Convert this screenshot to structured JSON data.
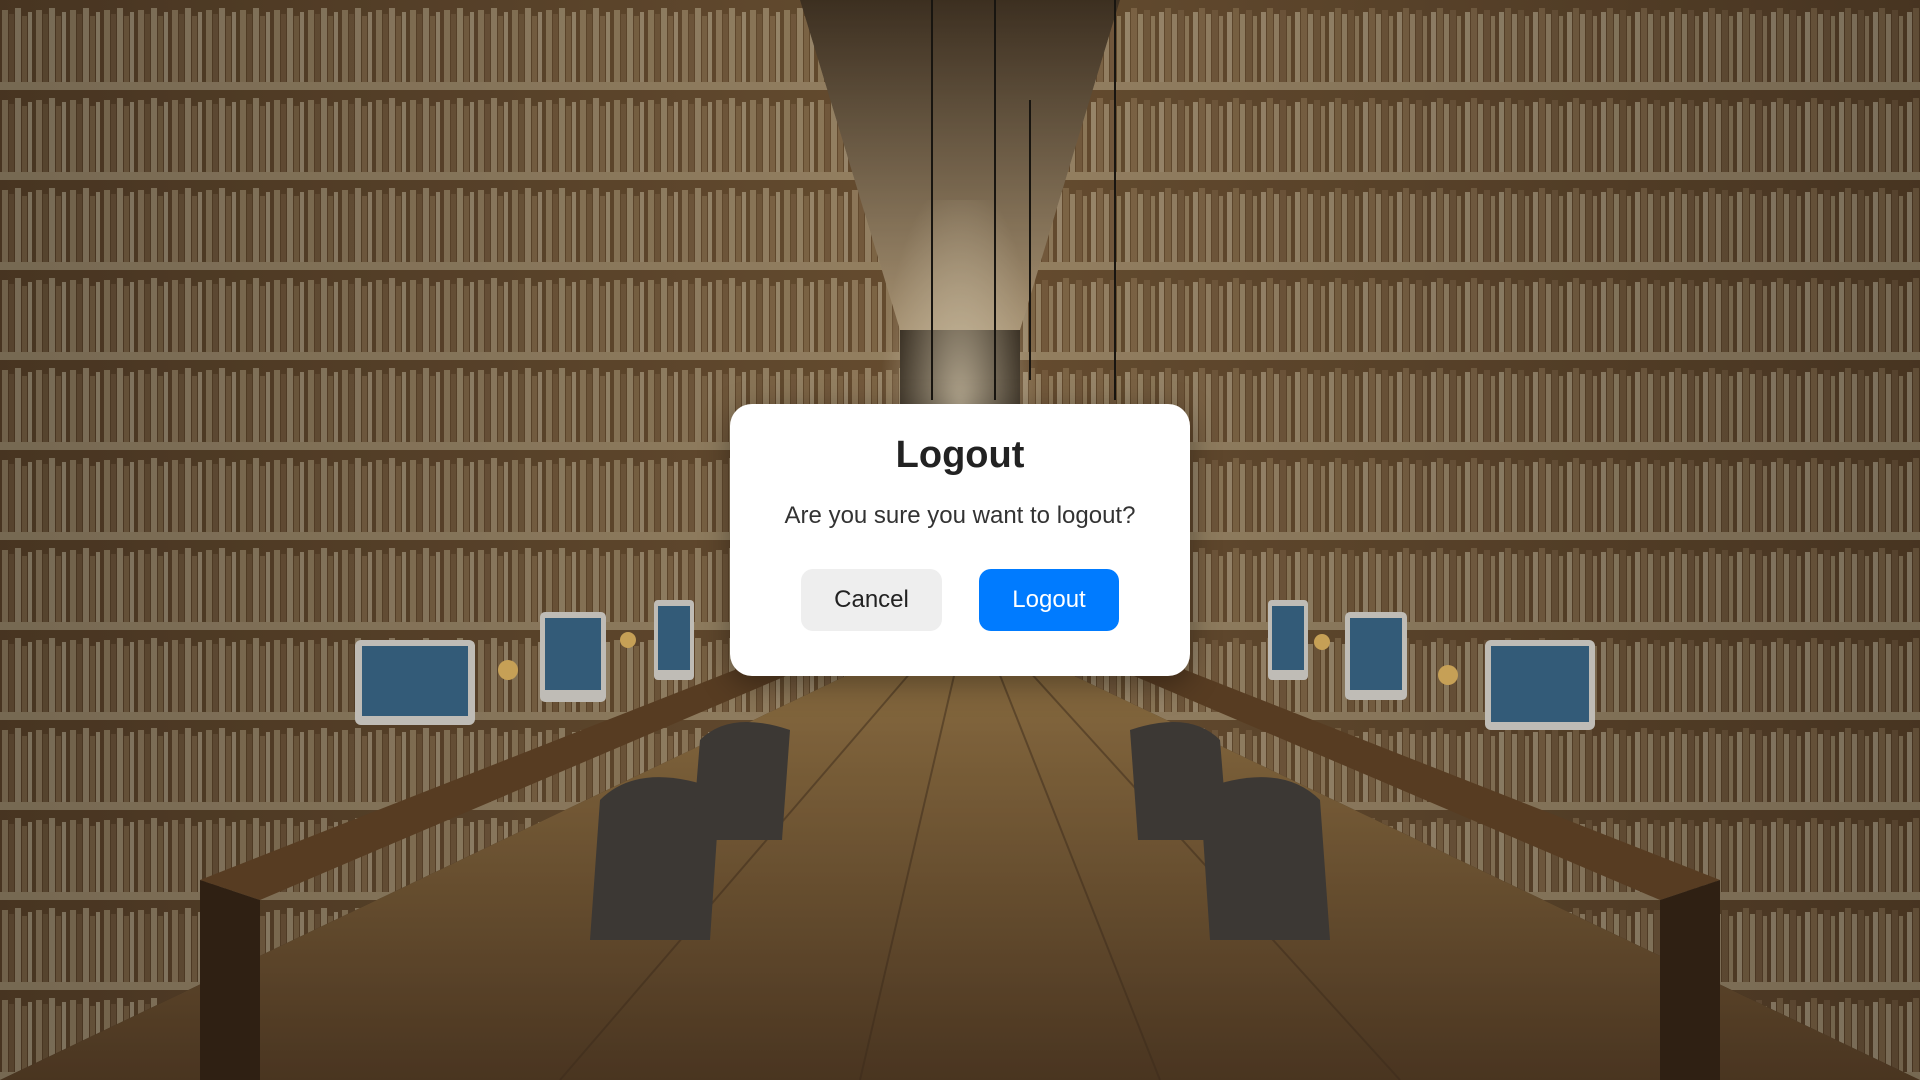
{
  "dialog": {
    "title": "Logout",
    "message": "Are you sure you want to logout?",
    "cancel_label": "Cancel",
    "confirm_label": "Logout"
  },
  "colors": {
    "confirm_button": "#007bff",
    "cancel_button": "#eeeeee",
    "dialog_background": "#ffffff"
  },
  "background": {
    "scene": "library hall with bookshelves and computer desks"
  }
}
